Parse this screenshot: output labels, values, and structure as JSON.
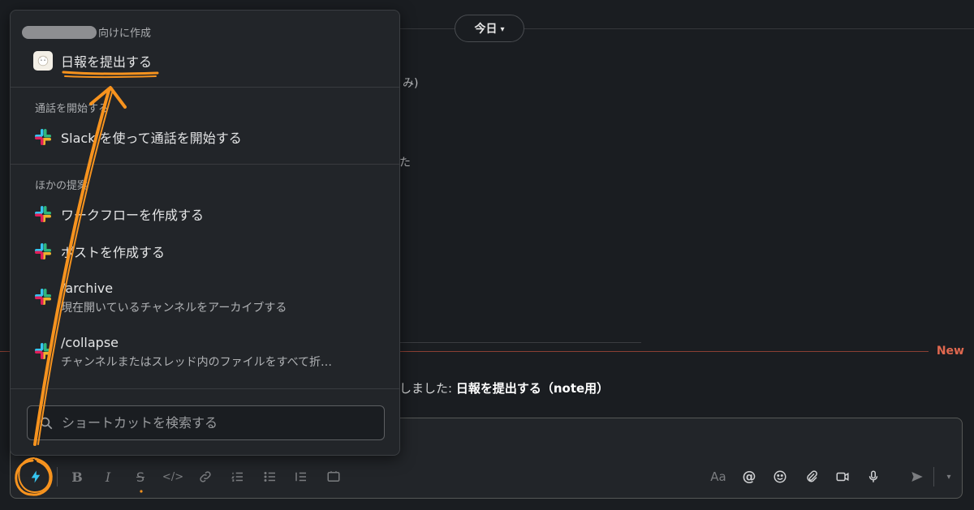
{
  "channel": {
    "date_label": "今日",
    "fragments": [
      "み)",
      "た"
    ],
    "new_label": "New",
    "message_prefix": "しました: ",
    "message_workflow": "日報を提出する",
    "message_suffix": "（note用）"
  },
  "menu": {
    "section1_title_suffix": "向けに作成",
    "item_report": "日報を提出する",
    "section2_title": "通話を開始する",
    "item_call": "Slack を使って通話を開始する",
    "section3_title": "ほかの提案",
    "item_workflow": "ワークフローを作成する",
    "item_post": "ポストを作成する",
    "item_archive": "/archive",
    "item_archive_desc": "現在開いているチャンネルをアーカイブする",
    "item_collapse": "/collapse",
    "item_collapse_desc": "チャンネルまたはスレッド内のファイルをすべて折…",
    "search_placeholder": "ショートカットを検索する"
  },
  "composer": {
    "format_label": "Aa"
  },
  "icons": {
    "shortcut": "lightning-icon",
    "bold": "bold-icon",
    "italic": "italic-icon",
    "strike": "strikethrough-icon",
    "code": "code-icon",
    "link": "link-icon",
    "ordered_list": "ordered-list-icon",
    "bullet_list": "bullet-list-icon",
    "block_list": "block-list-icon",
    "code_block": "code-block-icon",
    "mention": "at-icon",
    "emoji": "emoji-icon",
    "attach": "paperclip-icon",
    "video": "video-icon",
    "mic": "microphone-icon",
    "send": "send-icon",
    "send_options": "chevron-down-icon"
  },
  "colors": {
    "background": "#1a1d21",
    "popup": "#222529",
    "new_accent": "#e0684f",
    "annotation": "#f7931e",
    "lightning": "#36c5f0"
  }
}
